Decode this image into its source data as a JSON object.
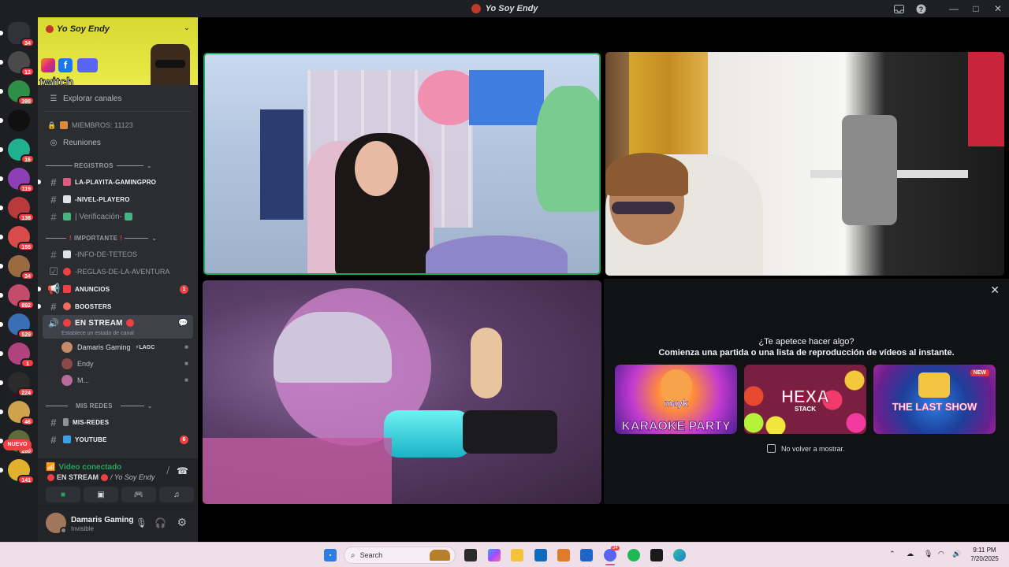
{
  "window": {
    "title": "Yo Soy Endy",
    "inbox_icon": "inbox-icon",
    "help_icon": "help-icon",
    "minimize": "—",
    "maximize": "□",
    "close": "✕"
  },
  "servers": [
    {
      "badge": "34",
      "color": "#313338"
    },
    {
      "badge": "13",
      "color": "#4a4a4a"
    },
    {
      "badge": "398",
      "color": "#2f8f47"
    },
    {
      "badge": "",
      "color": "#101010"
    },
    {
      "badge": "16",
      "color": "#1fb08f"
    },
    {
      "badge": "119",
      "color": "#8d3fb3"
    },
    {
      "badge": "138",
      "color": "#b83a3a"
    },
    {
      "badge": "155",
      "color": "#d94b4b"
    },
    {
      "badge": "34",
      "color": "#9a6b3f"
    },
    {
      "badge": "892",
      "color": "#c24c6a"
    },
    {
      "badge": "529",
      "color": "#3b6fb5"
    },
    {
      "badge": "1",
      "color": "#b0427e"
    },
    {
      "badge": "224",
      "color": "#2b2b2b"
    },
    {
      "badge": "46",
      "color": "#d1a24e"
    },
    {
      "badge": "260",
      "color": "#5b6b3a"
    },
    {
      "badge": "141",
      "color": "#e0b12d"
    }
  ],
  "new_label": "NUEVO",
  "server": {
    "name": "Yo Soy Endy",
    "twitch_text": "twitch"
  },
  "channels": {
    "explore": "Explorar canales",
    "members": "MIEMBROS: 11123",
    "events": "Reuniones",
    "cat_registros": "REGISTROS",
    "ch_playita": "LA-PLAYITA-GAMINGPRO",
    "ch_nivel": "-NIVEL-PLAYERO",
    "ch_verif": "| Verificación-",
    "cat_importante": "IMPORTANTE",
    "ch_info": "-INFO-DE-TETEOS",
    "ch_reglas": "-REGLAS-DE-LA-AVENTURA",
    "ch_anuncios": "ANUNCIOS",
    "ch_anuncios_count": "1",
    "ch_boosters": "BOOSTERS",
    "ch_stream": "EN STREAM",
    "ch_stream_status": "Establece un estado de canal",
    "vu1_name": "Damaris Gaming",
    "vu1_tag": "LAGC",
    "vu2_name": "Endy",
    "vu3_name": "M...",
    "cat_redes": "MIS REDES",
    "ch_misredes": "MIS-REDES",
    "ch_youtube": "YOUTUBE",
    "ch_youtube_count": "6"
  },
  "voice": {
    "status": "Video conectado",
    "channel": "EN STREAM",
    "server_suffix": "/ Yo Soy Endy"
  },
  "user": {
    "name": "Damaris Gaming",
    "status": "Invisible"
  },
  "activity": {
    "question": "¿Te apetece hacer algo?",
    "subtitle": "Comienza una partida o una lista de reproducción de vídeos al instante.",
    "games": [
      {
        "title": "KARAOKE PARTY",
        "brand": "mayk"
      },
      {
        "title": "HEXA",
        "sub": "STACK"
      },
      {
        "title": "THE LAST SHOW",
        "badge": "NEW"
      }
    ],
    "dont_show": "No volver a mostrar."
  },
  "taskbar": {
    "search": "Search",
    "time": "9:11 PM",
    "date": "7/20/2025",
    "discord_badge": "34"
  }
}
